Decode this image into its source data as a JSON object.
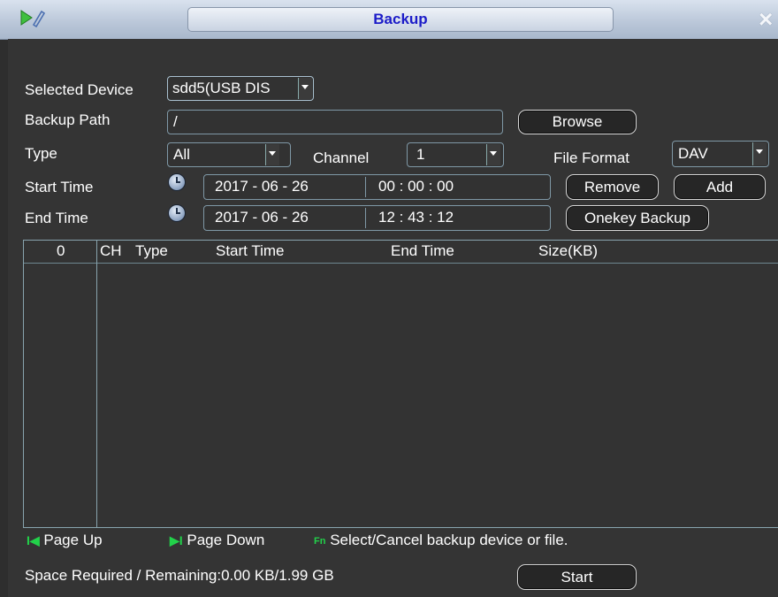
{
  "window": {
    "title": "Backup",
    "app_icon": "play-pencil-icon",
    "close_icon": "close-icon"
  },
  "form": {
    "selected_device": {
      "label": "Selected Device",
      "value": "sdd5(USB DIS"
    },
    "backup_path": {
      "label": "Backup Path",
      "value": "/",
      "browse_label": "Browse"
    },
    "type": {
      "label": "Type",
      "value": "All"
    },
    "channel": {
      "label": "Channel",
      "value": "1"
    },
    "file_format": {
      "label": "File Format",
      "value": "DAV"
    },
    "start_time": {
      "label": "Start Time",
      "date": "2017  - 06 - 26",
      "time": "00 : 00 : 00"
    },
    "end_time": {
      "label": "End Time",
      "date": "2017  - 06 - 26",
      "time": "12 : 43 : 12"
    },
    "remove_label": "Remove",
    "add_label": "Add",
    "onekey_label": "Onekey Backup"
  },
  "table": {
    "count": "0",
    "columns": [
      "CH",
      "Type",
      "Start Time",
      "End Time",
      "Size(KB)"
    ],
    "rows": []
  },
  "footer": {
    "page_up": "Page Up",
    "page_down": "Page Down",
    "fn_badge": "Fn",
    "fn_hint": "Select/Cancel backup device or file.",
    "space": "Space Required / Remaining:0.00 KB/1.99 GB",
    "start_label": "Start"
  },
  "colors": {
    "title_text": "#1c1cc8",
    "background": "#343434",
    "nav_icon": "#22d24a",
    "border": "#88a4ae"
  }
}
